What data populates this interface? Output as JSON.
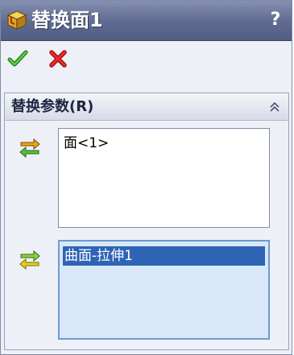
{
  "window": {
    "title": "替换面1",
    "help_label": "?",
    "icon": "feature-cube-icon"
  },
  "actions": {
    "ok_icon": "green-check-icon",
    "cancel_icon": "red-x-icon"
  },
  "group": {
    "title": "替换参数(R)",
    "collapse_icon": "double-chevron-up-icon"
  },
  "target_faces": {
    "icon": "replace-target-faces-icon",
    "items": [
      "面<1>"
    ]
  },
  "replacement_faces": {
    "icon": "replace-with-faces-icon",
    "items": [
      "曲面-拉伸1"
    ]
  },
  "colors": {
    "title_bar": "#5e6a8f",
    "selection": "#2f64b5",
    "active_list_bg": "#d8e8f8",
    "ok_green": "#2e9e1f",
    "cancel_red": "#d42020"
  }
}
